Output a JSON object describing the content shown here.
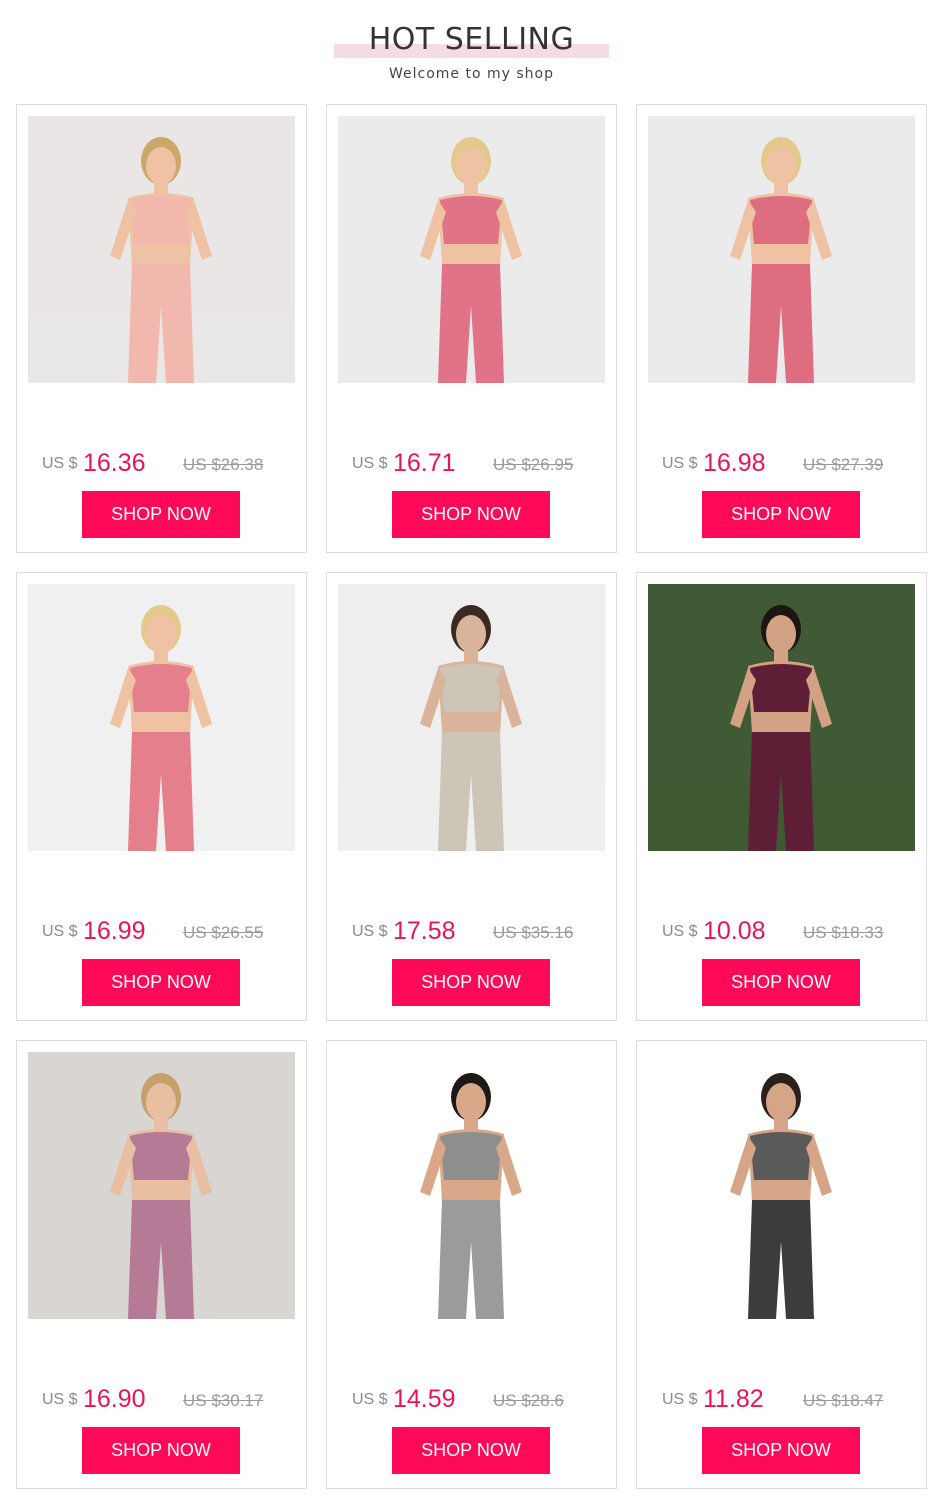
{
  "header": {
    "title": "HOT SELLING",
    "subtitle": "Welcome to my shop"
  },
  "products": [
    {
      "currency": "US $",
      "price": "16.36",
      "old_price": "US $26.38",
      "button": "SHOP NOW",
      "image": {
        "bg": "#eae6e6",
        "top": "#f2b8ad",
        "bottom": "#f2b8ad",
        "skin": "#efc2a4",
        "hair": "#c9a86a"
      }
    },
    {
      "currency": "US $",
      "price": "16.71",
      "old_price": "US $26.95",
      "button": "SHOP NOW",
      "image": {
        "bg": "#ebebeb",
        "top": "#e07387",
        "bottom": "#e07387",
        "skin": "#efc2a4",
        "hair": "#e3c98b"
      }
    },
    {
      "currency": "US $",
      "price": "16.98",
      "old_price": "US $27.39",
      "button": "SHOP NOW",
      "image": {
        "bg": "#ebebeb",
        "top": "#df6d80",
        "bottom": "#df6d80",
        "skin": "#efc2a4",
        "hair": "#e3c98b"
      }
    },
    {
      "currency": "US $",
      "price": "16.99",
      "old_price": "US $26.55",
      "button": "SHOP NOW",
      "image": {
        "bg": "#f0f0f0",
        "top": "#e57f8c",
        "bottom": "#e57f8c",
        "skin": "#efc2a4",
        "hair": "#e3c98b"
      }
    },
    {
      "currency": "US $",
      "price": "17.58",
      "old_price": "US $35.16",
      "button": "SHOP NOW",
      "image": {
        "bg": "#eeeeee",
        "top": "#cdc5b8",
        "bottom": "#cdc5b8",
        "skin": "#d9b39a",
        "hair": "#3b2a22"
      }
    },
    {
      "currency": "US $",
      "price": "10.08",
      "old_price": "US $18.33",
      "button": "SHOP NOW",
      "image": {
        "bg": "#3f5a34",
        "top": "#5e1f36",
        "bottom": "#5e1f36",
        "skin": "#d3a284",
        "hair": "#1c1512"
      }
    },
    {
      "currency": "US $",
      "price": "16.90",
      "old_price": "US $30.17",
      "button": "SHOP NOW",
      "image": {
        "bg": "#d8d5d2",
        "top": "#b57a95",
        "bottom": "#b57a95",
        "skin": "#e8bfa1",
        "hair": "#c5a06a"
      }
    },
    {
      "currency": "US $",
      "price": "14.59",
      "old_price": "US $28.6",
      "button": "SHOP NOW",
      "image": {
        "bg": "#ffffff",
        "top": "#8e8e8e",
        "bottom": "#9b9b9b",
        "skin": "#d9a889",
        "hair": "#1e1816"
      }
    },
    {
      "currency": "US $",
      "price": "11.82",
      "old_price": "US $18.47",
      "button": "SHOP NOW",
      "image": {
        "bg": "#ffffff",
        "top": "#5a5a5a",
        "bottom": "#3c3c3c",
        "skin": "#d6a587",
        "hair": "#2a201c"
      }
    }
  ]
}
